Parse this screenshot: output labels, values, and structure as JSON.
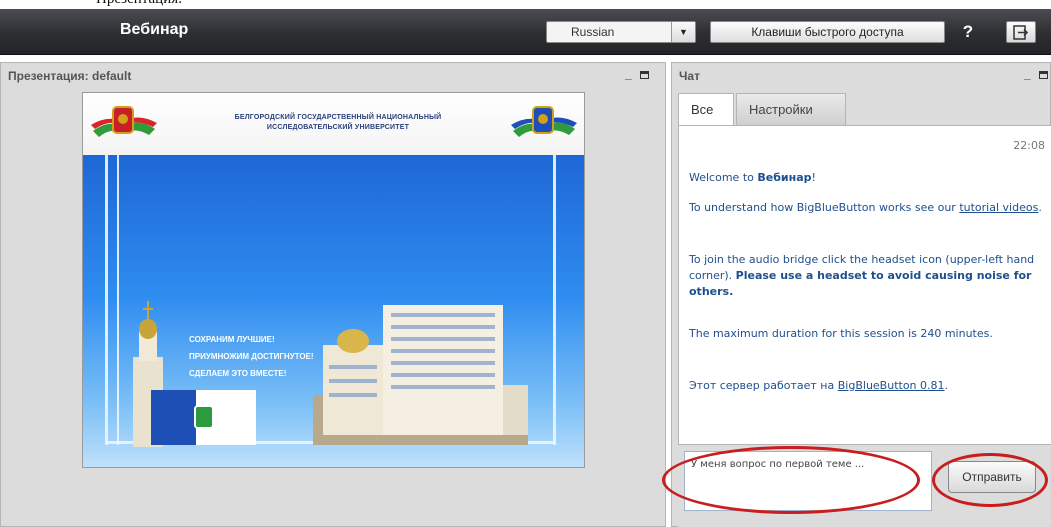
{
  "caption": {
    "text": "Презентация:"
  },
  "topbar": {
    "app_title": "Вебинар",
    "language": "Russian",
    "shortcut_label": "Клавиши быстрого доступа",
    "help_label": "?"
  },
  "presentation": {
    "title": "Презентация: default",
    "slide": {
      "header_line1": "БЕЛГОРОДСКИЙ ГОСУДАРСТВЕННЫЙ НАЦИОНАЛЬНЫЙ",
      "header_line2": "ИССЛЕДОВАТЕЛЬСКИЙ УНИВЕРСИТЕТ",
      "slogan_line1": "СОХРАНИМ ЛУЧШИЕ!",
      "slogan_line2": "ПРИУМНОЖИМ ДОСТИГНУТОЕ!",
      "slogan_line3": "СДЕЛАЕМ ЭТО ВМЕСТЕ!"
    }
  },
  "chat": {
    "title": "Чат",
    "tabs": [
      "Все",
      "Настройки"
    ],
    "time": "22:08",
    "welcome_prefix": "Welcome to ",
    "welcome_name": "Вебинар",
    "welcome_suffix": "!",
    "tutorial_prefix": "To understand how BigBlueButton works see our ",
    "tutorial_link": "tutorial videos",
    "tutorial_suffix": ".",
    "audio_text": "To join the audio bridge click the headset icon (upper-left hand corner). ",
    "audio_bold": "Please use a headset to avoid causing noise for others.",
    "duration_text": "The maximum duration for this session is 240 minutes.",
    "server_prefix": "Этот сервер работает на ",
    "server_link": "BigBlueButton 0.81",
    "server_suffix": ".",
    "input_value": "У меня вопрос по первой теме ...",
    "send_label": "Отправить"
  },
  "colors": {
    "highlight": "#c81e1e",
    "chat_text": "#1e4f8e",
    "topbar": "#2c2e32"
  }
}
